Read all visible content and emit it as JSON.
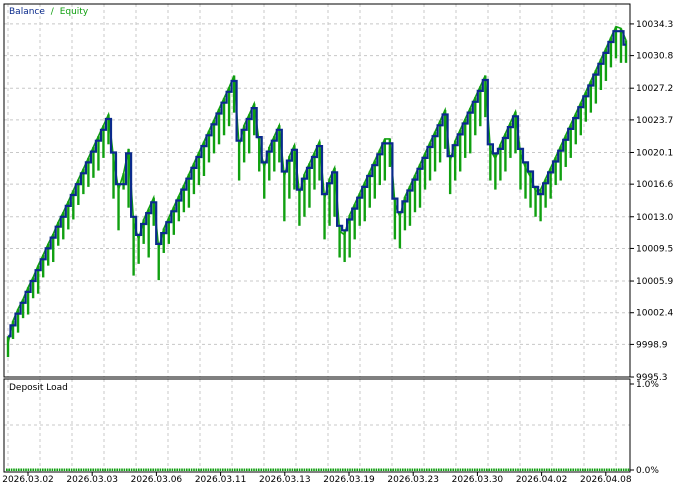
{
  "chart_data": [
    {
      "type": "line",
      "legend": {
        "items": [
          "Balance",
          "Equity"
        ],
        "separator": "/",
        "placement": "top-left"
      },
      "colors": {
        "Balance": "#0a2a8c",
        "Equity": "#10a010",
        "grid": "#c8c8c8",
        "frame": "#000000"
      },
      "ylim": [
        9995.3,
        10036.5
      ],
      "yticks": [
        "10034.3",
        "10030.8",
        "10027.2",
        "10023.7",
        "10020.1",
        "10016.6",
        "10013.0",
        "10009.5",
        "10005.9",
        "10002.4",
        "9998.9",
        "9995.3"
      ],
      "grid": true,
      "series": [
        {
          "name": "Balance",
          "style": "step",
          "values": [
            9999.8,
            10001.0,
            10002.3,
            10003.5,
            10004.7,
            10005.9,
            10007.1,
            10008.3,
            10009.5,
            10010.7,
            10011.9,
            10013.0,
            10014.2,
            10015.4,
            10016.6,
            10017.8,
            10019.0,
            10020.2,
            10021.4,
            10022.6,
            10023.8,
            10020.1,
            10016.6,
            10016.6,
            10020.0,
            10013.0,
            10011.0,
            10012.2,
            10013.4,
            10014.6,
            10010.0,
            10011.2,
            10012.4,
            10013.6,
            10014.8,
            10016.0,
            10017.2,
            10018.4,
            10019.6,
            10020.8,
            10022.0,
            10023.2,
            10024.4,
            10025.6,
            10026.8,
            10028.0,
            10021.4,
            10022.6,
            10023.8,
            10025.0,
            10021.8,
            10019.0,
            10020.2,
            10021.4,
            10022.6,
            10018.0,
            10019.2,
            10020.4,
            10016.0,
            10017.2,
            10018.4,
            10019.6,
            10020.8,
            10015.5,
            10016.7,
            10017.9,
            10012.0,
            10011.5,
            10012.7,
            10013.9,
            10015.1,
            10016.3,
            10017.5,
            10018.7,
            10019.9,
            10021.1,
            10021.1,
            10015.0,
            10013.5,
            10014.7,
            10015.9,
            10017.1,
            10018.3,
            10019.5,
            10020.7,
            10021.9,
            10023.1,
            10024.3,
            10019.7,
            10020.9,
            10022.1,
            10023.3,
            10024.5,
            10025.7,
            10026.9,
            10028.1,
            10021.0,
            10020.0,
            10020.5,
            10021.7,
            10022.9,
            10024.1,
            10020.5,
            10019.0,
            10018.0,
            10016.3,
            10015.5,
            10016.7,
            10017.9,
            10019.1,
            10020.3,
            10021.5,
            10022.7,
            10023.9,
            10025.1,
            10026.3,
            10027.5,
            10028.7,
            10029.9,
            10031.1,
            10032.3,
            10033.5,
            10033.5,
            10032.0
          ]
        },
        {
          "name": "Equity",
          "style": "spiky",
          "values": [
            9999.0,
            10001.5,
            10002.8,
            10003.9,
            10005.2,
            10006.3,
            10007.6,
            10008.8,
            10010.0,
            10011.1,
            10012.4,
            10013.5,
            10014.7,
            10015.9,
            10017.1,
            10018.3,
            10019.5,
            10020.7,
            10021.9,
            10023.1,
            10024.3,
            10019.5,
            10016.0,
            10017.8,
            10020.5,
            10012.4,
            10010.5,
            10012.7,
            10013.9,
            10015.1,
            10009.5,
            10011.7,
            10012.9,
            10014.1,
            10015.3,
            10016.5,
            10017.7,
            10018.9,
            10020.1,
            10021.3,
            10022.5,
            10023.7,
            10024.9,
            10026.1,
            10027.3,
            10028.6,
            10020.8,
            10023.1,
            10024.3,
            10025.5,
            10021.1,
            10018.4,
            10020.7,
            10021.9,
            10023.1,
            10017.4,
            10019.7,
            10020.9,
            10015.5,
            10017.7,
            10018.9,
            10020.1,
            10021.3,
            10015.0,
            10017.2,
            10018.4,
            10011.4,
            10011.0,
            10013.2,
            10014.4,
            10015.6,
            10016.8,
            10018.0,
            10019.2,
            10020.4,
            10021.6,
            10021.6,
            10014.4,
            10013.0,
            10015.2,
            10016.4,
            10017.6,
            10018.8,
            10020.0,
            10021.2,
            10022.4,
            10023.6,
            10024.8,
            10019.1,
            10021.4,
            10022.6,
            10023.8,
            10025.0,
            10026.2,
            10027.4,
            10028.6,
            10020.4,
            10019.4,
            10021.0,
            10022.2,
            10023.4,
            10024.6,
            10020.0,
            10018.4,
            10017.4,
            10015.8,
            10016.0,
            10017.2,
            10018.4,
            10019.6,
            10020.8,
            10022.0,
            10023.2,
            10024.4,
            10025.6,
            10026.8,
            10028.0,
            10029.2,
            10030.4,
            10031.6,
            10032.8,
            10034.0,
            10033.8,
            10032.5
          ],
          "dips": [
            9997.5,
            9999.5,
            10000.2,
            10001.8,
            10002.2,
            10004.0,
            10004.5,
            10006.3,
            10007.6,
            10008.0,
            10009.8,
            10010.5,
            10011.6,
            10012.7,
            10014.3,
            10015.5,
            10016.3,
            10017.3,
            10018.1,
            10019.5,
            10021.0,
            10015.0,
            10011.5,
            10016.0,
            10014.0,
            10006.5,
            10007.8,
            10010.0,
            10008.5,
            10012.0,
            10006.0,
            10009.0,
            10010.0,
            10011.0,
            10012.5,
            10013.5,
            10014.0,
            10015.5,
            10016.5,
            10017.5,
            10019.0,
            10020.0,
            10021.0,
            10022.0,
            10023.0,
            10024.5,
            10017.0,
            10019.0,
            10020.0,
            10022.0,
            10018.0,
            10015.0,
            10017.0,
            10018.0,
            10019.0,
            10012.5,
            10015.0,
            10016.0,
            10012.0,
            10013.0,
            10014.0,
            10016.0,
            10017.0,
            10010.5,
            10012.0,
            10013.0,
            10008.5,
            10008.0,
            10008.5,
            10010.5,
            10012.0,
            10012.5,
            10014.0,
            10015.0,
            10016.5,
            10017.0,
            10018.5,
            10010.5,
            10009.5,
            10011.5,
            10012.0,
            10013.5,
            10014.0,
            10016.0,
            10017.0,
            10018.0,
            10019.0,
            10020.5,
            10015.5,
            10017.0,
            10018.0,
            10019.5,
            10020.0,
            10022.0,
            10023.0,
            10024.0,
            10017.0,
            10016.0,
            10017.0,
            10018.0,
            10019.5,
            10020.0,
            10016.0,
            10015.0,
            10014.0,
            10013.0,
            10012.5,
            10014.0,
            10015.0,
            10016.5,
            10017.0,
            10018.5,
            10019.5,
            10021.0,
            10022.0,
            10023.5,
            10024.5,
            10025.5,
            10027.0,
            10028.0,
            10029.5,
            10030.5,
            10030.0,
            10030.0
          ]
        }
      ]
    },
    {
      "type": "bar",
      "label": "Deposit Load",
      "ylim": [
        0,
        1.0
      ],
      "yticks": [
        "1.0%",
        "0.0%"
      ],
      "color": "#10a010",
      "value": 0.0
    }
  ],
  "xaxis": {
    "ticks": [
      "2026.03.02",
      "2026.03.03",
      "2026.03.06",
      "2026.03.11",
      "2026.03.13",
      "2026.03.19",
      "2026.03.23",
      "2026.03.30",
      "2026.04.02",
      "2026.04.08"
    ]
  }
}
